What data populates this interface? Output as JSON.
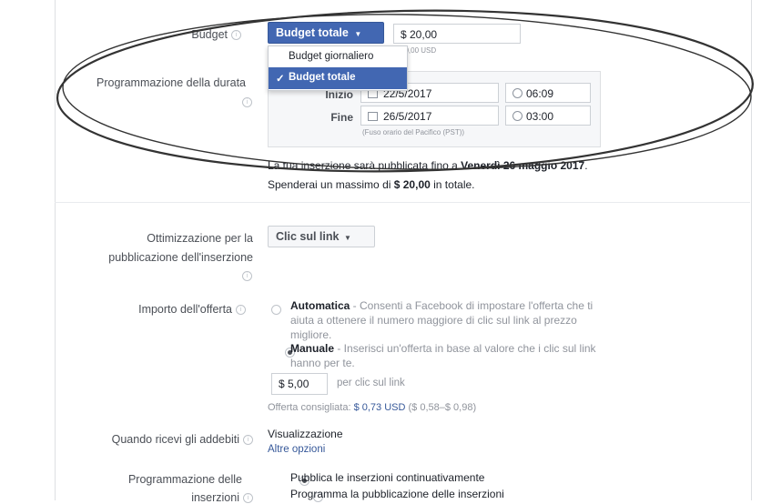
{
  "budget": {
    "label": "Budget",
    "dropdown_label": "Budget totale",
    "amount": "$ 20,00",
    "amount_hint": "20,00 USD",
    "menu": {
      "option1": "Budget giornaliero",
      "option2": "Budget totale"
    }
  },
  "schedule": {
    "label": "Programmazione della durata",
    "start_label": "Inizio",
    "start_date": "22/5/2017",
    "start_time": "06:09",
    "end_label": "Fine",
    "end_date": "26/5/2017",
    "end_time": "03:00",
    "timezone": "(Fuso orario del Pacifico (PST))"
  },
  "summary": {
    "line1_prefix": "La tua inserzione sarà pubblicata fino a ",
    "line1_date": "Venerdì 26 maggio 2017",
    "line1_suffix": ".",
    "line2_prefix": "Spenderai un massimo di ",
    "line2_amount": "$ 20,00",
    "line2_suffix": " in totale."
  },
  "optimization": {
    "label_line1": "Ottimizzazione per la",
    "label_line2": "pubblicazione dell'inserzione",
    "value": "Clic sul link"
  },
  "bid": {
    "label": "Importo dell'offerta",
    "auto_title": "Automatica",
    "auto_desc_l1": " - Consenti a Facebook di impostare l'offerta che ti",
    "auto_desc_l2": "aiuta a ottenere il numero maggiore di clic sul link al prezzo",
    "auto_desc_l3": "migliore.",
    "manual_title": "Manuale",
    "manual_desc_l1": " - Inserisci un'offerta in base al valore che i clic sul link",
    "manual_desc_l2": "hanno per te.",
    "amount": "$ 5,00",
    "per": "per clic sul link",
    "suggested_prefix": "Offerta consigliata: ",
    "suggested_value": "$ 0,73 USD",
    "suggested_range": " ($ 0,58–$ 0,98)"
  },
  "charges": {
    "label": "Quando ricevi gli addebiti",
    "value": "Visualizzazione",
    "more": "Altre opzioni"
  },
  "delivery": {
    "label_line1": "Programmazione delle",
    "label_line2": "inserzioni",
    "option1": "Pubblica le inserzioni continuativamente",
    "option2": "Programma la pubblicazione delle inserzioni"
  }
}
